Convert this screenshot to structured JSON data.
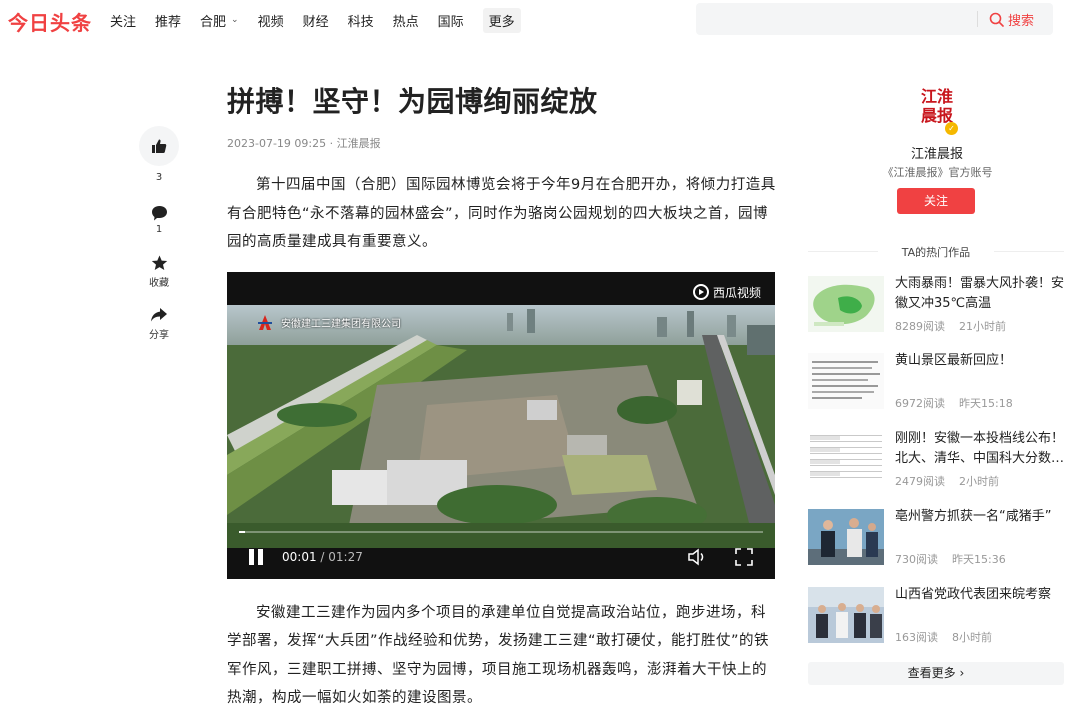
{
  "header": {
    "logo": "今日头条",
    "nav": [
      {
        "label": "关注"
      },
      {
        "label": "推荐"
      },
      {
        "label": "合肥"
      },
      {
        "label": "视频"
      },
      {
        "label": "财经"
      },
      {
        "label": "科技"
      },
      {
        "label": "热点"
      },
      {
        "label": "国际"
      },
      {
        "label": "更多"
      }
    ],
    "search": {
      "placeholder": "",
      "button": "搜索"
    }
  },
  "side_actions": {
    "like_count": "3",
    "comment_count": "1",
    "favorite_label": "收藏",
    "share_label": "分享"
  },
  "article": {
    "title": "拼搏！坚守！为园博绚丽绽放",
    "meta": "2023-07-19 09:25 · 江淮晨报",
    "para1": "第十四届中国（合肥）国际园林博览会将于今年9月在合肥开办，将倾力打造具有合肥特色“永不落幕的园林盛会”，同时作为骆岗公园规划的四大板块之首，园博园的高质量建成具有重要意义。",
    "para2": "安徽建工三建作为园内多个项目的承建单位自觉提高政治站位，跑步进场，科学部署，发挥“大兵团”作战经验和优势，发扬建工三建“敢打硬仗，能打胜仗”的铁军作风，三建职工拼搏、坚守为园博，项目施工现场机器轰鸣，澎湃着大干快上的热潮，构成一幅如火如荼的建设图景。"
  },
  "video": {
    "brand": "西瓜视频",
    "watermark": "安徽建工三建集团有限公司",
    "current_time": "00:01",
    "separator": " / ",
    "duration": "01:27",
    "progress": 0.012
  },
  "author": {
    "logo_text": "江淮晨报",
    "name": "江淮晨报",
    "desc": "《江淮晨报》官方账号",
    "follow": "关注"
  },
  "hot": {
    "title": "TA的热门作品",
    "items": [
      {
        "text": "大雨暴雨！雷暴大风扑袭！安徽又冲35℃高温",
        "reads": "8289阅读",
        "time": "21小时前"
      },
      {
        "text": "黄山景区最新回应！",
        "reads": "6972阅读",
        "time": "昨天15:18"
      },
      {
        "text": "刚刚！安徽一本投档线公布！北大、清华、中国科大分数…",
        "reads": "2479阅读",
        "time": "2小时前"
      },
      {
        "text": "亳州警方抓获一名“咸猪手”",
        "reads": "730阅读",
        "time": "昨天15:36"
      },
      {
        "text": "山西省党政代表团来皖考察",
        "reads": "163阅读",
        "time": "8小时前"
      }
    ],
    "more": "查看更多"
  },
  "colors": {
    "brand_red": "#f04142",
    "author_red": "#c8161d"
  }
}
